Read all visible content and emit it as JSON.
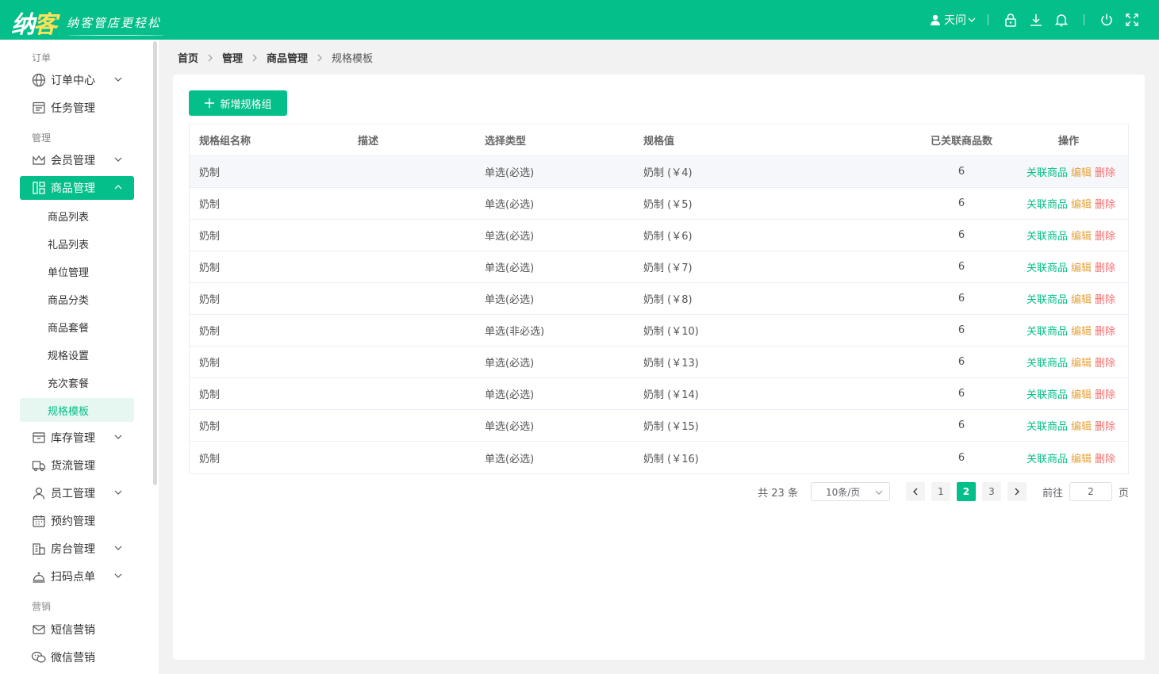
{
  "brand": {
    "name_left": "纳",
    "name_right": "客",
    "slogan": "纳客管店更轻松"
  },
  "header": {
    "user_name": "天问"
  },
  "sidebar": {
    "groups": [
      "订单",
      "管理",
      "营销"
    ],
    "items": [
      {
        "label": "订单中心"
      },
      {
        "label": "任务管理"
      },
      {
        "label": "会员管理"
      },
      {
        "label": "商品管理"
      },
      {
        "label": "库存管理"
      },
      {
        "label": "货流管理"
      },
      {
        "label": "员工管理"
      },
      {
        "label": "预约管理"
      },
      {
        "label": "房台管理"
      },
      {
        "label": "扫码点单"
      },
      {
        "label": "短信营销"
      },
      {
        "label": "微信营销"
      }
    ],
    "sub_items": [
      "商品列表",
      "礼品列表",
      "单位管理",
      "商品分类",
      "商品套餐",
      "规格设置",
      "充次套餐",
      "规格模板"
    ]
  },
  "breadcrumb": [
    "首页",
    "管理",
    "商品管理",
    "规格模板"
  ],
  "toolbar": {
    "add_label": "新增规格组"
  },
  "table": {
    "headers": [
      "规格组名称",
      "描述",
      "选择类型",
      "规格值",
      "已关联商品数",
      "操作"
    ],
    "action_labels": {
      "link": "关联商品",
      "edit": "编辑",
      "delete": "删除"
    },
    "rows": [
      {
        "name": "奶制",
        "desc": "",
        "type": "单选(必选)",
        "value": "奶制 (￥4)",
        "count": "6"
      },
      {
        "name": "奶制",
        "desc": "",
        "type": "单选(必选)",
        "value": "奶制 (￥5)",
        "count": "6"
      },
      {
        "name": "奶制",
        "desc": "",
        "type": "单选(必选)",
        "value": "奶制 (￥6)",
        "count": "6"
      },
      {
        "name": "奶制",
        "desc": "",
        "type": "单选(必选)",
        "value": "奶制 (￥7)",
        "count": "6"
      },
      {
        "name": "奶制",
        "desc": "",
        "type": "单选(必选)",
        "value": "奶制 (￥8)",
        "count": "6"
      },
      {
        "name": "奶制",
        "desc": "",
        "type": "单选(非必选)",
        "value": "奶制 (￥10)",
        "count": "6"
      },
      {
        "name": "奶制",
        "desc": "",
        "type": "单选(必选)",
        "value": "奶制 (￥13)",
        "count": "6"
      },
      {
        "name": "奶制",
        "desc": "",
        "type": "单选(必选)",
        "value": "奶制 (￥14)",
        "count": "6"
      },
      {
        "name": "奶制",
        "desc": "",
        "type": "单选(必选)",
        "value": "奶制 (￥15)",
        "count": "6"
      },
      {
        "name": "奶制",
        "desc": "",
        "type": "单选(必选)",
        "value": "奶制 (￥16)",
        "count": "6"
      }
    ]
  },
  "pagination": {
    "total_text": "共 23 条",
    "page_size": "10条/页",
    "pages": [
      "1",
      "2",
      "3"
    ],
    "current": "2",
    "goto_label": "前往",
    "goto_value": "2",
    "page_suffix": "页"
  },
  "colors": {
    "primary": "#04bf89",
    "edit": "#e6a23c",
    "delete": "#f56c6c"
  },
  "icons": [
    "user-icon",
    "lock-icon",
    "download-icon",
    "bell-icon",
    "power-icon",
    "fullscreen-icon",
    "globe-icon",
    "task-icon",
    "crown-icon",
    "grid-icon",
    "box-icon",
    "truck-icon",
    "person-icon",
    "calendar-icon",
    "building-icon",
    "bell-service-icon",
    "mail-icon",
    "wechat-icon",
    "plus-icon"
  ]
}
